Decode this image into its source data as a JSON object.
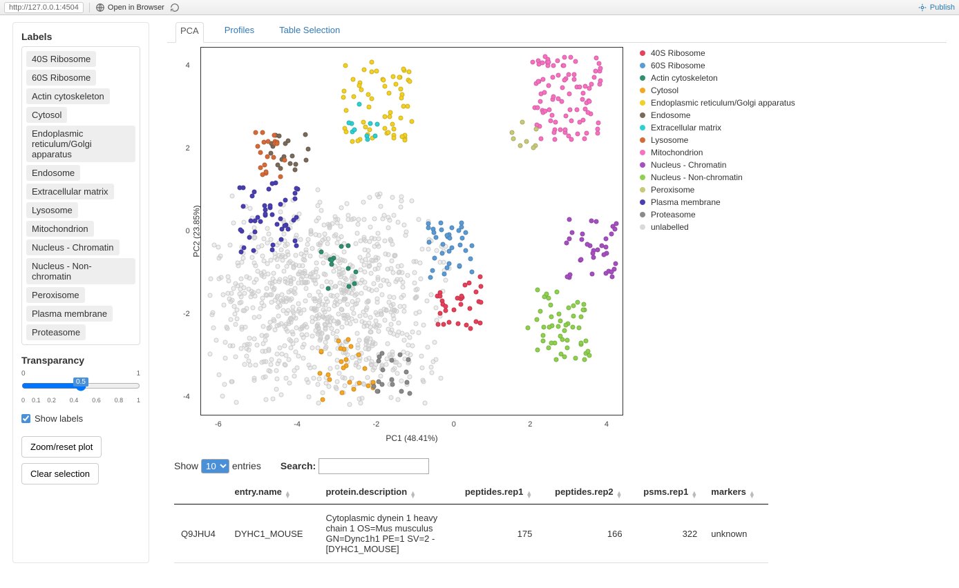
{
  "toolbar": {
    "url": "http://127.0.0.1:4504",
    "open_browser": "Open in Browser",
    "publish": "Publish"
  },
  "sidebar": {
    "labels_title": "Labels",
    "labels": [
      "40S Ribosome",
      "60S Ribosome",
      "Actin cytoskeleton",
      "Cytosol",
      "Endoplasmic reticulum/Golgi apparatus",
      "Endosome",
      "Extracellular matrix",
      "Lysosome",
      "Mitochondrion",
      "Nucleus - Chromatin",
      "Nucleus - Non-chromatin",
      "Peroxisome",
      "Plasma membrane",
      "Proteasome"
    ],
    "transparency_title": "Transparancy",
    "transparency_min": "0",
    "transparency_max": "1",
    "transparency_value": "0.5",
    "transparency_ticks": [
      "0",
      "0.1",
      "0.2",
      "",
      "0.4",
      "",
      "0.6",
      "",
      "0.8",
      "",
      "1"
    ],
    "show_labels": "Show labels",
    "zoom_btn": "Zoom/reset plot",
    "clear_btn": "Clear selection"
  },
  "tabs": [
    "PCA",
    "Profiles",
    "Table Selection"
  ],
  "chart_data": {
    "type": "scatter",
    "xlabel": "PC1 (48.41%)",
    "ylabel": "PC2 (23.85%)",
    "xlim": [
      -6,
      5
    ],
    "ylim": [
      -4,
      4
    ],
    "x_ticks": [
      "-6",
      "-4",
      "-2",
      "0",
      "2",
      "4"
    ],
    "y_ticks": [
      "4",
      "2",
      "0",
      "-2",
      "-4"
    ],
    "series": [
      {
        "name": "40S Ribosome",
        "color": "#e6405a",
        "cx": 0.7,
        "cy": -1.5,
        "n": 30,
        "spread": 0.6
      },
      {
        "name": "60S Ribosome",
        "color": "#5b9bd5",
        "cx": 0.5,
        "cy": -0.4,
        "n": 35,
        "spread": 0.6
      },
      {
        "name": "Actin cytoskeleton",
        "color": "#2f8f6f",
        "cx": -2.4,
        "cy": -0.8,
        "n": 12,
        "spread": 0.5
      },
      {
        "name": "Cytosol",
        "color": "#f5a623",
        "cx": -2.2,
        "cy": -3.0,
        "n": 25,
        "spread": 0.7
      },
      {
        "name": "Endoplasmic reticulum/Golgi apparatus",
        "color": "#f2d024",
        "cx": -1.4,
        "cy": 2.8,
        "n": 60,
        "spread": 0.9
      },
      {
        "name": "Endosome",
        "color": "#7a6a5a",
        "cx": -3.7,
        "cy": 1.8,
        "n": 18,
        "spread": 0.5
      },
      {
        "name": "Extracellular matrix",
        "color": "#2fd0d0",
        "cx": -1.8,
        "cy": 2.4,
        "n": 10,
        "spread": 0.4
      },
      {
        "name": "Lysosome",
        "color": "#d66b3a",
        "cx": -4.3,
        "cy": 1.7,
        "n": 20,
        "spread": 0.5
      },
      {
        "name": "Mitochondrion",
        "color": "#f771c1",
        "cx": 3.5,
        "cy": 2.9,
        "n": 90,
        "spread": 0.9
      },
      {
        "name": "Nucleus - Chromatin",
        "color": "#a64fc1",
        "cx": 4.2,
        "cy": -0.4,
        "n": 40,
        "spread": 0.7
      },
      {
        "name": "Nucleus - Non-chromatin",
        "color": "#8fd14f",
        "cx": 3.3,
        "cy": -2.0,
        "n": 50,
        "spread": 0.8
      },
      {
        "name": "Peroxisome",
        "color": "#c9c97a",
        "cx": 2.4,
        "cy": 2.2,
        "n": 8,
        "spread": 0.4
      },
      {
        "name": "Plasma membrane",
        "color": "#4a3fb0",
        "cx": -4.2,
        "cy": 0.3,
        "n": 45,
        "spread": 0.8
      },
      {
        "name": "Proteasome",
        "color": "#8a8a8a",
        "cx": -1.0,
        "cy": -3.1,
        "n": 18,
        "spread": 0.5
      },
      {
        "name": "unlabelled",
        "color": "#d9d9d9",
        "cx": 0,
        "cy": 0,
        "n": 900,
        "spread": 3.5
      }
    ]
  },
  "table": {
    "show_label": "Show",
    "entries_label": "entries",
    "page_size": "10",
    "search_label": "Search:",
    "columns": [
      "",
      "entry.name",
      "protein.description",
      "peptides.rep1",
      "peptides.rep2",
      "psms.rep1",
      "markers"
    ],
    "rows": [
      {
        "id": "Q9JHU4",
        "entry": "DYHC1_MOUSE",
        "desc": "Cytoplasmic dynein 1 heavy chain 1 OS=Mus musculus GN=Dync1h1 PE=1 SV=2 - [DYHC1_MOUSE]",
        "p1": "175",
        "p2": "166",
        "psm": "322",
        "marker": "unknown"
      }
    ]
  }
}
